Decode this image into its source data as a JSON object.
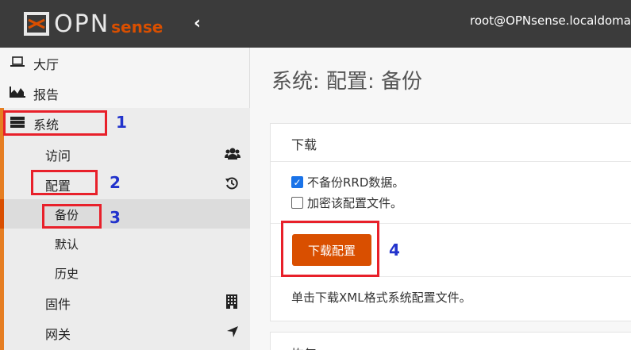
{
  "header": {
    "logo_text": "OPN",
    "logo_suffix": "sense",
    "collapse_icon": "chevron-left",
    "user": "root@OPNsense.localdomain"
  },
  "sidebar": {
    "items": [
      {
        "label": "大厅",
        "icon": "laptop-icon"
      },
      {
        "label": "报告",
        "icon": "area-chart-icon"
      },
      {
        "label": "系统",
        "icon": "server-icon"
      },
      {
        "label": "访问",
        "icon": "users-icon"
      },
      {
        "label": "配置",
        "icon": "history-icon"
      },
      {
        "label": "备份"
      },
      {
        "label": "默认"
      },
      {
        "label": "历史"
      },
      {
        "label": "固件",
        "icon": "building-icon"
      },
      {
        "label": "网关",
        "icon": "location-arrow-icon"
      }
    ]
  },
  "main": {
    "title": "系统: 配置: 备份",
    "download_section": {
      "heading": "下载",
      "option1": "不备份RRD数据。",
      "option1_checked": true,
      "option2": "加密该配置文件。",
      "option2_checked": false,
      "button": "下载配置",
      "help": "单击下载XML格式系统配置文件。"
    },
    "restore_section": {
      "heading": "恢复"
    }
  },
  "annotations": [
    "1",
    "2",
    "3",
    "4"
  ],
  "colors": {
    "topbar": "#3b3b3b",
    "accent": "#d94f00",
    "annotation_box": "#e8202a",
    "annotation_number": "#2233cc"
  }
}
